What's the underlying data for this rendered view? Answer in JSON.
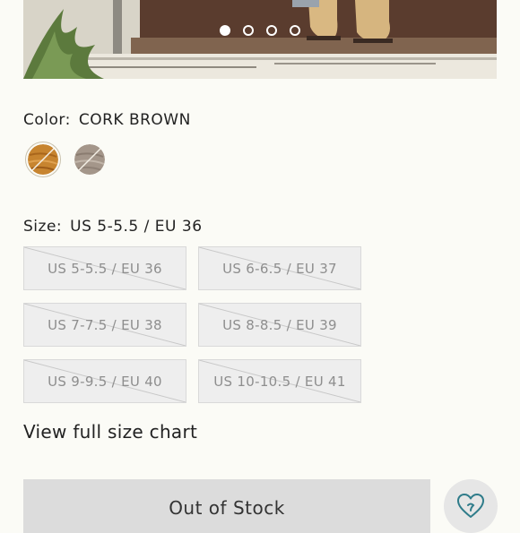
{
  "carousel": {
    "slide_count": 4,
    "active_index": 0
  },
  "color": {
    "label": "Color:",
    "value": "CORK BROWN",
    "swatches": [
      {
        "name": "cork-brown",
        "color": "#c7842f",
        "selected": true
      },
      {
        "name": "taupe",
        "color": "#a4968a",
        "selected": false
      }
    ]
  },
  "size": {
    "label": "Size:",
    "value": "US 5-5.5 / EU 36",
    "options": [
      {
        "label": "US 5-5.5 / EU 36",
        "available": false
      },
      {
        "label": "US 6-6.5 / EU 37",
        "available": false
      },
      {
        "label": "US 7-7.5 / EU 38",
        "available": false
      },
      {
        "label": "US 8-8.5 / EU 39",
        "available": false
      },
      {
        "label": "US 9-9.5 / EU 40",
        "available": false
      },
      {
        "label": "US 10-10.5 / EU 41",
        "available": false
      }
    ]
  },
  "size_chart_link": "View full size chart",
  "cart_button": "Out of Stock",
  "wishlist": {
    "icon": "heart-plus-icon",
    "color": "#2f7c8a"
  }
}
